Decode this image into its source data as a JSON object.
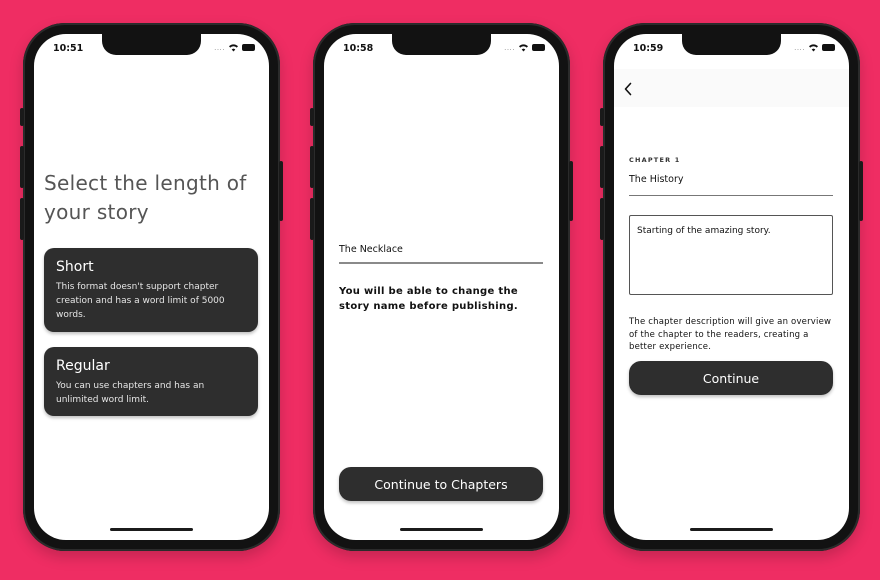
{
  "colors": {
    "background": "#ef2d63",
    "card": "#2e2e2e",
    "screen": "#ffffff"
  },
  "screens": [
    {
      "time": "10:51",
      "title": "Select the length of your story",
      "options": [
        {
          "title": "Short",
          "description": "This format doesn't support chapter creation and has a word limit of 5000 words."
        },
        {
          "title": "Regular",
          "description": "You can use chapters and has an unlimited word limit."
        }
      ]
    },
    {
      "time": "10:58",
      "story_name_value": "The Necklace",
      "note": "You will be able to change the story name before publishing.",
      "continue_label": "Continue to Chapters"
    },
    {
      "time": "10:59",
      "back_icon": "chevron-left-icon",
      "chapter_label": "CHAPTER 1",
      "chapter_title_value": "The History",
      "chapter_description_value": "Starting of the amazing story.",
      "note": "The chapter description will give an overview of the chapter to the readers, creating a better experience.",
      "continue_label": "Continue"
    }
  ],
  "status_signal": "....",
  "status_icons": [
    "wifi-icon",
    "battery-icon"
  ]
}
